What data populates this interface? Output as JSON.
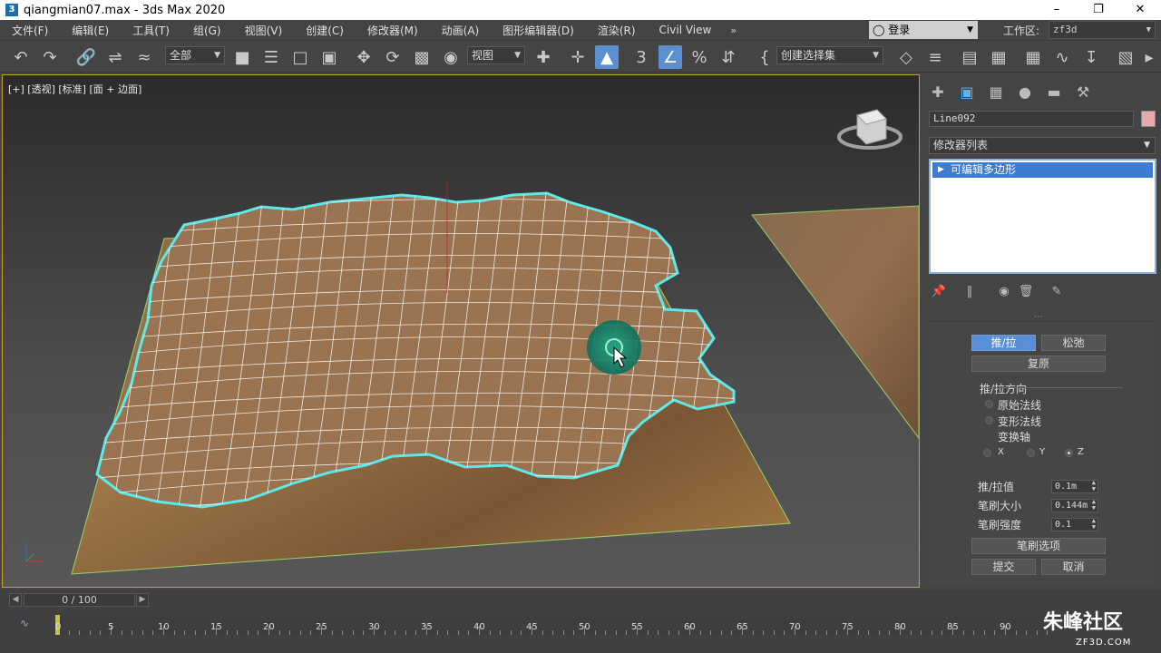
{
  "window": {
    "title": "qiangmian07.max - 3ds Max 2020",
    "app_icon": "3"
  },
  "menu": [
    "文件(F)",
    "编辑(E)",
    "工具(T)",
    "组(G)",
    "视图(V)",
    "创建(C)",
    "修改器(M)",
    "动画(A)",
    "图形编辑器(D)",
    "渲染(R)",
    "Civil View"
  ],
  "menu_more": "»",
  "login": {
    "label": "登录",
    "icon": "user-icon"
  },
  "workspace": {
    "label": "工作区:",
    "value": "zf3d"
  },
  "toolbar": {
    "selection_filter": "全部",
    "reference_coord": "视图",
    "named_selection": "创建选择集"
  },
  "viewport": {
    "label": "[+] [透视] [标准] [面 + 边面]",
    "active_border_color": "#c9a227",
    "selection_outline_color": "#5fe8e8"
  },
  "command_panel": {
    "tabs": [
      "create-icon",
      "modify-icon",
      "hierarchy-icon",
      "motion-icon",
      "display-icon",
      "utilities-icon"
    ],
    "object_name": "Line092",
    "object_color": "#e4a9a9",
    "modifier_list_label": "修改器列表",
    "stack_items": [
      "可编辑多边形"
    ],
    "paint_deform": {
      "push_pull": "推/拉",
      "relax": "松弛",
      "revert": "复原",
      "direction_group": "推/拉方向",
      "original_normals": "原始法线",
      "deformed_normals": "变形法线",
      "transform_axis": "变换轴",
      "axis_x": "X",
      "axis_y": "Y",
      "axis_z": "Z",
      "push_pull_value_label": "推/拉值",
      "push_pull_value": "0.1m",
      "brush_size_label": "笔刷大小",
      "brush_size": "0.144m",
      "brush_strength_label": "笔刷强度",
      "brush_strength": "0.1",
      "brush_options": "笔刷选项",
      "commit": "提交",
      "cancel": "取消"
    }
  },
  "timeline": {
    "slider": "0 / 100",
    "ticks": [
      "0",
      "5",
      "10",
      "15",
      "20",
      "25",
      "30",
      "35",
      "40",
      "45",
      "50",
      "55",
      "60",
      "65",
      "70",
      "75",
      "80",
      "85",
      "90"
    ]
  },
  "watermark": {
    "main": "朱峰社区",
    "sub": "ZF3D.COM"
  }
}
